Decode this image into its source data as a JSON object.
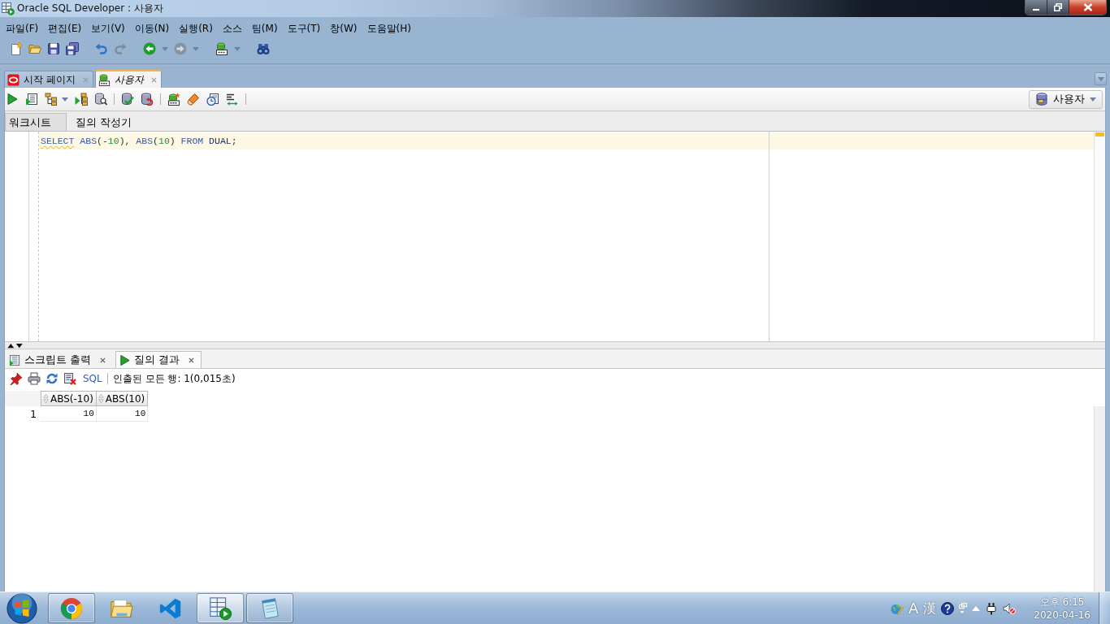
{
  "window": {
    "title": "Oracle SQL Developer : 사용자"
  },
  "menu": [
    "파일(F)",
    "편집(E)",
    "보기(V)",
    "이동(N)",
    "실행(R)",
    "소스",
    "팀(M)",
    "도구(T)",
    "창(W)",
    "도움말(H)"
  ],
  "main_toolbar": [
    {
      "disabled": false
    },
    {
      "disabled": false
    },
    {
      "disabled": false
    },
    {
      "disabled": false
    },
    {
      "disabled": false
    },
    {
      "disabled": true
    },
    {
      "disabled": false
    },
    {
      "disabled": true
    },
    {
      "disabled": false
    },
    {
      "disabled": false
    }
  ],
  "editor_tabs": [
    {
      "label": "시작 페이지",
      "kind": "start_page",
      "selected": false
    },
    {
      "label": "사용자",
      "kind": "worksheet",
      "selected": true
    }
  ],
  "connection": {
    "label": "사용자"
  },
  "subtabs": [
    {
      "label": "워크시트",
      "selected": true
    },
    {
      "label": "질의 작성기",
      "selected": false
    }
  ],
  "editor": {
    "lines": [
      {
        "current": true,
        "tokens": [
          {
            "text": "SELECT",
            "kind": "keyword",
            "warning": true
          },
          {
            "text": " ABS",
            "kind": "keyword",
            "warning": false
          },
          {
            "text": "(-",
            "kind": "punct",
            "warning": false
          },
          {
            "text": "10",
            "kind": "number",
            "warning": false
          },
          {
            "text": "),",
            "kind": "punct",
            "warning": false
          },
          {
            "text": " ABS",
            "kind": "keyword",
            "warning": false
          },
          {
            "text": "(",
            "kind": "punct",
            "warning": false
          },
          {
            "text": "10",
            "kind": "number",
            "warning": false
          },
          {
            "text": ")",
            "kind": "punct",
            "warning": false
          },
          {
            "text": " FROM",
            "kind": "keyword",
            "warning": false
          },
          {
            "text": " DUAL",
            "kind": "ident",
            "warning": false
          },
          {
            "text": ";",
            "kind": "punct",
            "warning": false
          }
        ]
      }
    ]
  },
  "output_tabs": [
    {
      "label": "스크립트 출력",
      "kind": "script_output",
      "selected": false
    },
    {
      "label": "질의 결과",
      "kind": "query_result",
      "selected": true
    }
  ],
  "result_toolbar": {
    "sql_link": "SQL",
    "status": "인출된 모든 행: 1(0,015초)"
  },
  "grid": {
    "columns": [
      "ABS(-10)",
      "ABS(10)"
    ],
    "rows": [
      {
        "number": "1",
        "cells": [
          "10",
          "10"
        ]
      }
    ]
  },
  "taskbar": {
    "apps": [
      {
        "running": true,
        "selected": false
      },
      {
        "running": false,
        "selected": false
      },
      {
        "running": false,
        "selected": false
      },
      {
        "running": true,
        "selected": true
      },
      {
        "running": true,
        "selected": false
      }
    ],
    "tray": {
      "ime_mode": "A",
      "ime_hanja": "漢",
      "time": "오후 6:15",
      "date": "2020-04-16"
    }
  }
}
